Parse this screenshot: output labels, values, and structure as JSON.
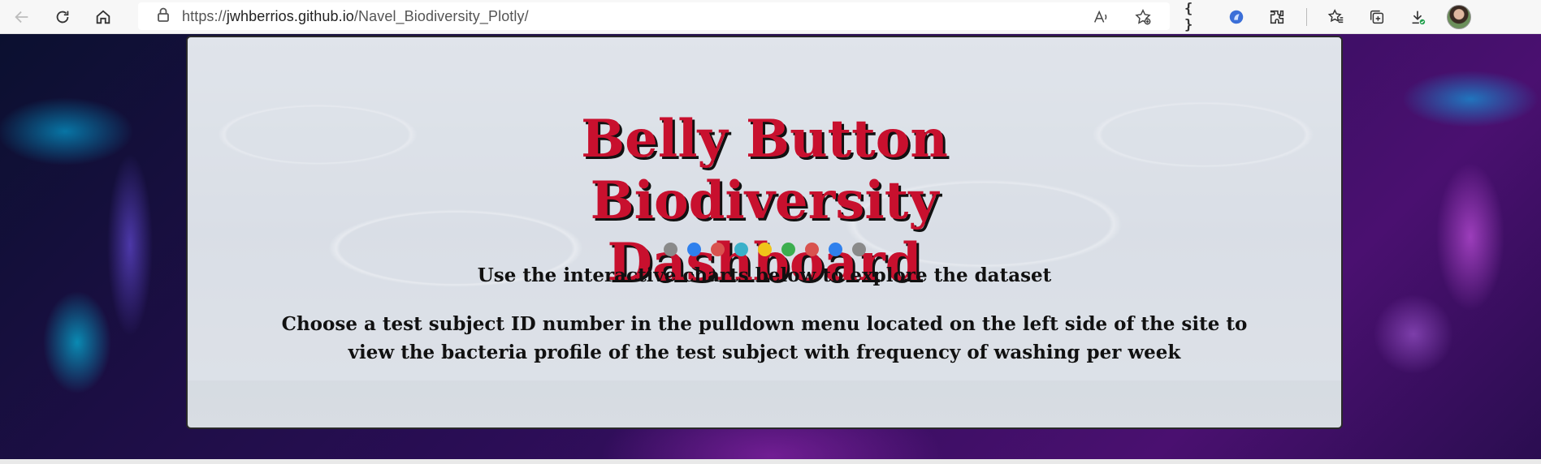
{
  "browser": {
    "url_prefix": "https://",
    "url_host": "jwhberrios.github.io",
    "url_path": "/Navel_Biodiversity_Plotly/",
    "dev_tools_label": "{ }"
  },
  "header": {
    "title": "Belly Button Biodiversity Dashboard",
    "subtitle": "Use the interactive charts below to explore the dataset",
    "instructions": "Choose a test subject ID number in the pulldown menu located on the left side of the site to view the bacteria profile of the test subject with frequency of washing per week"
  },
  "dots": [
    {
      "color": "#8a8a8a"
    },
    {
      "color": "#2f80ed"
    },
    {
      "color": "#d9534f"
    },
    {
      "color": "#3bb0c9"
    },
    {
      "color": "#f0c419"
    },
    {
      "color": "#3cae4f"
    },
    {
      "color": "#d9534f"
    },
    {
      "color": "#2f80ed"
    },
    {
      "color": "#8a8a8a"
    }
  ],
  "icons": {
    "back": "back-arrow-icon",
    "reload": "reload-icon",
    "home": "home-icon",
    "lock": "lock-icon",
    "read_aloud": "read-aloud-icon",
    "favorite_add": "favorite-add-icon",
    "extension": "extensions-icon",
    "favorites": "favorites-icon",
    "collections": "collections-icon",
    "downloads": "downloads-icon",
    "profile": "profile-avatar"
  }
}
